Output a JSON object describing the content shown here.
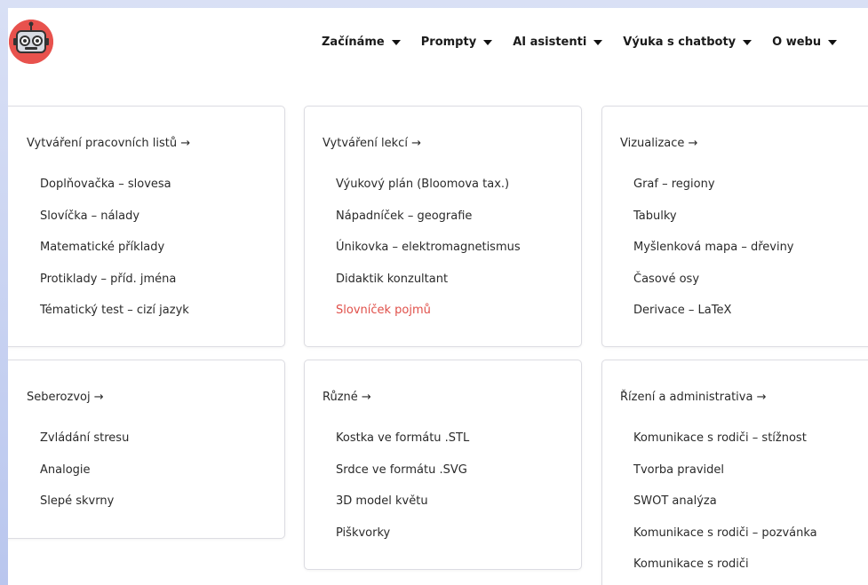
{
  "nav": [
    {
      "label": "Začínáme"
    },
    {
      "label": "Prompty"
    },
    {
      "label": "AI asistenti"
    },
    {
      "label": "Výuka s chatboty"
    },
    {
      "label": "O webu"
    }
  ],
  "cards": [
    {
      "title": "Vytváření pracovních listů →",
      "items": [
        "Doplňovačka – slovesa",
        "Slovíčka – nálady",
        "Matematické příklady",
        "Protiklady – příd. jména",
        "Tématický test – cizí jazyk"
      ]
    },
    {
      "title": "Vytváření lekcí →",
      "items": [
        "Výukový plán (Bloomova tax.)",
        "Nápadníček – geografie",
        "Únikovka – elektromagnetismus",
        "Didaktik konzultant",
        "Slovníček pojmů"
      ]
    },
    {
      "title": "Vizualizace →",
      "items": [
        "Graf – regiony",
        "Tabulky",
        "Myšlenková mapa – dřeviny",
        "Časové osy",
        "Derivace – LaTeX"
      ]
    },
    {
      "title": "Seberozvoj →",
      "items": [
        "Zvládání stresu",
        "Analogie",
        "Slepé skvrny"
      ]
    },
    {
      "title": "Různé →",
      "items": [
        "Kostka ve formátu .STL",
        "Srdce ve formátu .SVG",
        "3D model květu",
        "Piškvorky"
      ]
    },
    {
      "title": "Řízení a administrativa →",
      "items": [
        "Komunikace s rodiči – stížnost",
        "Tvorba pravidel",
        "SWOT analýza",
        "Komunikace s rodiči – pozvánka",
        "Komunikace s rodiči"
      ]
    }
  ],
  "colors": {
    "accent": "#e0504a",
    "logo_bg": "#e8524d",
    "frame": "#4a67c9"
  },
  "icons": {
    "logo": "robot-head-icon",
    "dropdown": "caret-down-icon"
  }
}
